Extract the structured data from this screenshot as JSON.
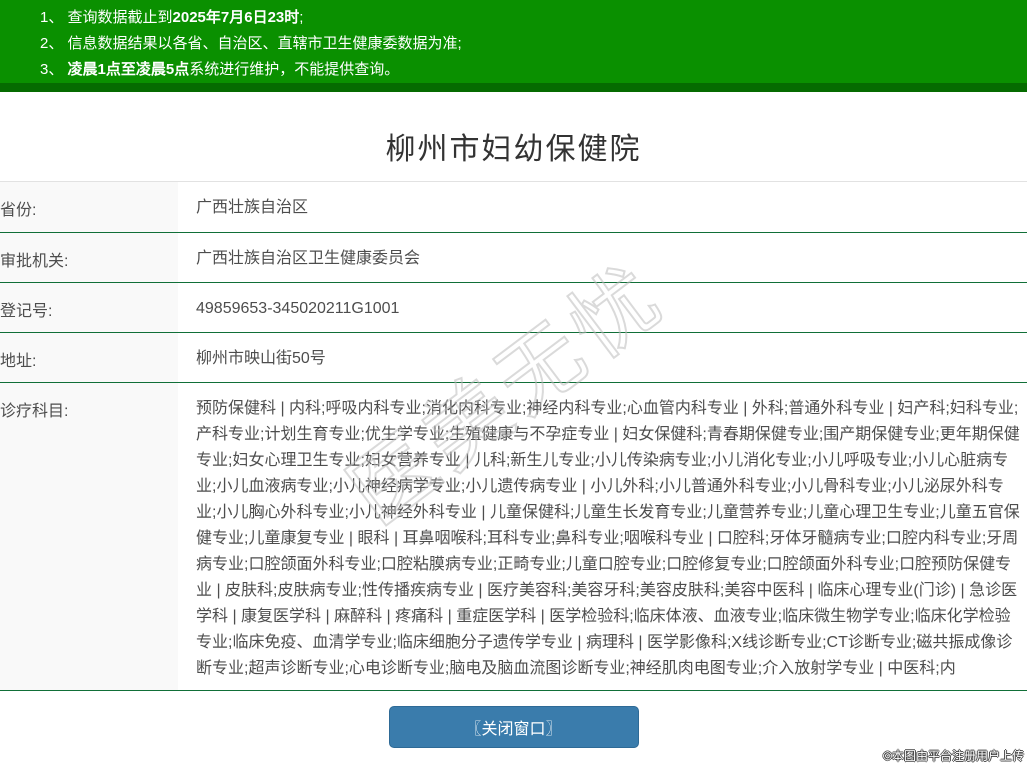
{
  "banner": {
    "items": [
      {
        "prefix": "1、 查询数据截止到",
        "bold": "2025年7月6日23时",
        "suffix": ";"
      },
      {
        "prefix": "2、 信息数据结果以各省、自治区、直辖市卫生健康委数据为准;",
        "bold": "",
        "suffix": ""
      },
      {
        "prefix": "3、 ",
        "bold": "凌晨1点至凌晨5点",
        "suffix": "系统进行维护，不能提供查询。"
      }
    ]
  },
  "page": {
    "title": "柳州市妇幼保健院"
  },
  "table": {
    "rows": [
      {
        "label": "省份:",
        "value": "广西壮族自治区"
      },
      {
        "label": "审批机关:",
        "value": "广西壮族自治区卫生健康委员会"
      },
      {
        "label": "登记号:",
        "value": "49859653-345020211G1001"
      },
      {
        "label": "地址:",
        "value": "柳州市映山街50号"
      },
      {
        "label": "诊疗科目:",
        "value": "预防保健科 | 内科;呼吸内科专业;消化内科专业;神经内科专业;心血管内科专业 | 外科;普通外科专业 | 妇产科;妇科专业;产科专业;计划生育专业;优生学专业;生殖健康与不孕症专业 | 妇女保健科;青春期保健专业;围产期保健专业;更年期保健专业;妇女心理卫生专业;妇女营养专业 | 儿科;新生儿专业;小儿传染病专业;小儿消化专业;小儿呼吸专业;小儿心脏病专业;小儿血液病专业;小儿神经病学专业;小儿遗传病专业 | 小儿外科;小儿普通外科专业;小儿骨科专业;小儿泌尿外科专业;小儿胸心外科专业;小儿神经外科专业 | 儿童保健科;儿童生长发育专业;儿童营养专业;儿童心理卫生专业;儿童五官保健专业;儿童康复专业 | 眼科 | 耳鼻咽喉科;耳科专业;鼻科专业;咽喉科专业 | 口腔科;牙体牙髓病专业;口腔内科专业;牙周病专业;口腔颌面外科专业;口腔粘膜病专业;正畸专业;儿童口腔专业;口腔修复专业;口腔颌面外科专业;口腔预防保健专业 | 皮肤科;皮肤病专业;性传播疾病专业 | 医疗美容科;美容牙科;美容皮肤科;美容中医科 | 临床心理专业(门诊) | 急诊医学科 | 康复医学科 | 麻醉科 | 疼痛科 | 重症医学科 | 医学检验科;临床体液、血液专业;临床微生物学专业;临床化学检验专业;临床免疫、血清学专业;临床细胞分子遗传学专业 | 病理科 | 医学影像科;X线诊断专业;CT诊断专业;磁共振成像诊断专业;超声诊断专业;心电诊断专业;脑电及脑血流图诊断专业;神经肌肉电图专业;介入放射学专业 | 中医科;内"
      }
    ]
  },
  "button": {
    "close_label": "〖关闭窗口〗"
  },
  "watermarks": {
    "diagonal": "医美无忧",
    "photo_credit": "©本图由平台注册用户上传"
  },
  "colors": {
    "banner_green": "#0a9000",
    "banner_green_dark": "#056b00",
    "divider_green": "#116f38",
    "button_blue": "#3a7cac"
  }
}
